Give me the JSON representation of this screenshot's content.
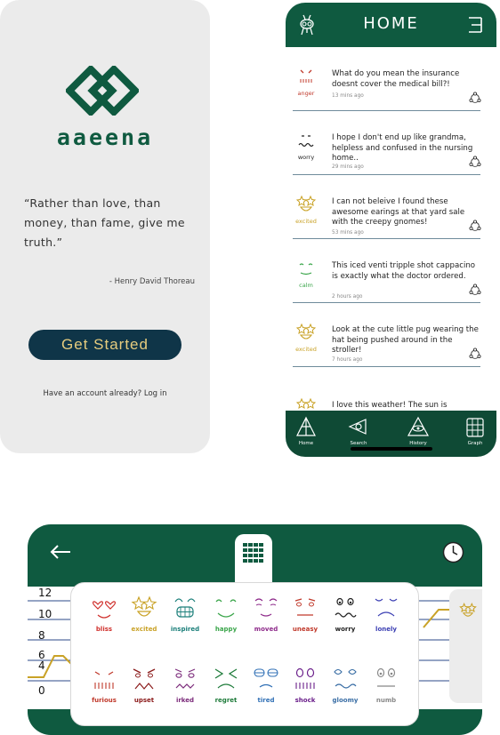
{
  "colors": {
    "brand_green": "#0f5a40",
    "cta_navy": "#0f3548",
    "cta_gold": "#e6cc7e",
    "card_grey": "#ebebeb"
  },
  "splash": {
    "logo_icon": "interlocking-diamonds-logo",
    "brand": "aaeena",
    "quote": "“Rather than love, than money, than fame, give me truth.”",
    "author": "- Henry David Thoreau",
    "cta": "Get Started",
    "have_account": "Have an account already?  Log in"
  },
  "home": {
    "title": "HOME",
    "posts": [
      {
        "mood": "anger",
        "mood_color": "#c0392b",
        "text": "What do you mean the insurance doesnt cover the medical bill?!",
        "time": "13 mins ago"
      },
      {
        "mood": "worry",
        "mood_color": "#222222",
        "text": "I hope I don't end up like grandma, helpless and confused in the nursing home..",
        "time": "29 mins ago"
      },
      {
        "mood": "excited",
        "mood_color": "#c9a227",
        "text": "I can not beleive I found these awesome earings at that yard sale with the creepy gnomes!",
        "time": "53 mins ago"
      },
      {
        "mood": "calm",
        "mood_color": "#3aa54a",
        "text": "This iced venti tripple shot cappacino is exactly what the doctor ordered.",
        "time": "2 hours ago"
      },
      {
        "mood": "excited",
        "mood_color": "#c9a227",
        "text": "Look at the cute little pug wearing the hat being pushed around in the stroller!",
        "time": "7 hours ago"
      },
      {
        "mood": "",
        "mood_color": "#c9a227",
        "text": "I love this weather!  The sun is",
        "time": ""
      }
    ],
    "tabs": [
      {
        "label": "Home",
        "icon": "pyramid-home-icon"
      },
      {
        "label": "Search",
        "icon": "eye-search-icon"
      },
      {
        "label": "History",
        "icon": "eye-pyramid-history-icon"
      },
      {
        "label": "Graph",
        "icon": "grid-graph-icon"
      }
    ]
  },
  "picker": {
    "y_axis": [
      "12",
      "10",
      "8",
      "6",
      "4",
      "0"
    ],
    "emotions": [
      {
        "label": "bliss",
        "color": "#d0312d"
      },
      {
        "label": "excited",
        "color": "#c9a227"
      },
      {
        "label": "inspired",
        "color": "#1b7f7a"
      },
      {
        "label": "happy",
        "color": "#3aa54a"
      },
      {
        "label": "moved",
        "color": "#8e2a8a"
      },
      {
        "label": "uneasy",
        "color": "#c0392b"
      },
      {
        "label": "worry",
        "color": "#222222"
      },
      {
        "label": "lonely",
        "color": "#3b3fb3"
      },
      {
        "label": "furious",
        "color": "#c0392b"
      },
      {
        "label": "upset",
        "color": "#8b1a1a"
      },
      {
        "label": "irked",
        "color": "#7b2a7a"
      },
      {
        "label": "regret",
        "color": "#1e7b3a"
      },
      {
        "label": "tired",
        "color": "#2f6fb5"
      },
      {
        "label": "shock",
        "color": "#6a1e8a"
      },
      {
        "label": "gloomy",
        "color": "#3a6ea5"
      },
      {
        "label": "numb",
        "color": "#888888"
      }
    ]
  }
}
